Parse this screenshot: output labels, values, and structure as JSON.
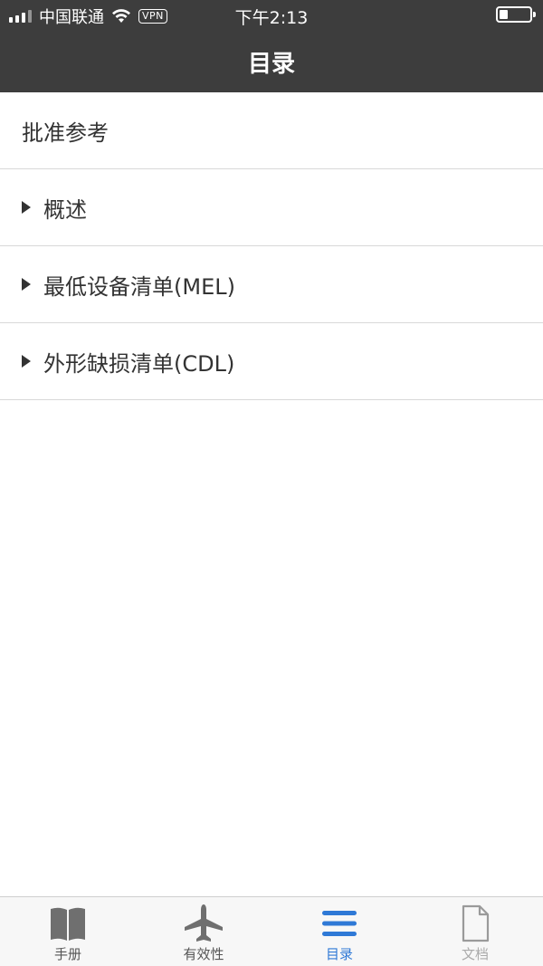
{
  "status": {
    "carrier": "中国联通",
    "vpn": "VPN",
    "time": "下午2:13"
  },
  "header": {
    "title": "目录"
  },
  "list": {
    "items": [
      {
        "label": "批准参考",
        "expandable": false
      },
      {
        "label": "概述",
        "expandable": true
      },
      {
        "label": "最低设备清单(MEL)",
        "expandable": true
      },
      {
        "label": "外形缺损清单(CDL)",
        "expandable": true
      }
    ]
  },
  "tabbar": {
    "tabs": [
      {
        "label": "手册",
        "icon": "book-icon"
      },
      {
        "label": "有效性",
        "icon": "airplane-icon"
      },
      {
        "label": "目录",
        "icon": "list-icon",
        "active": true
      },
      {
        "label": "文档",
        "icon": "document-icon",
        "disabled": true
      }
    ]
  },
  "colors": {
    "header_bg": "#3d3d3d",
    "active_tab": "#2f79d6"
  }
}
